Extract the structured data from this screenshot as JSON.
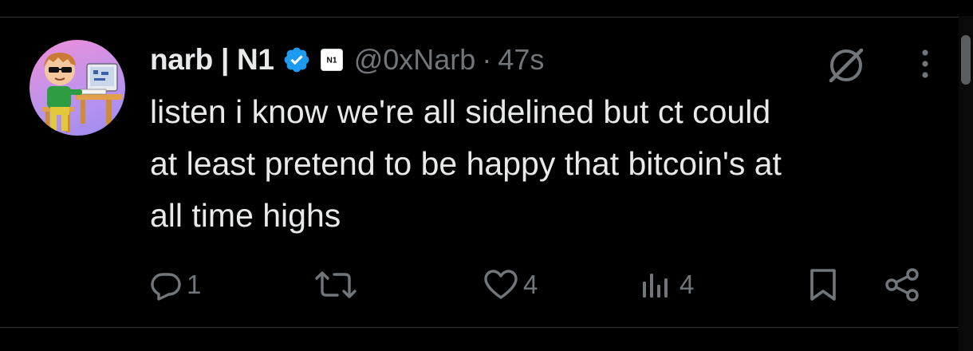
{
  "post": {
    "author_name": "narb | N1",
    "handle": "@0xNarb",
    "separator": "·",
    "timestamp": "47s",
    "text": "listen i know we're all sidelined but ct could\nat least pretend to be happy that bitcoin's at\nall time highs"
  },
  "badges": {
    "verified_color": "#1d9bf0",
    "affiliate_logo_text": "N1"
  },
  "actions": {
    "reply_count": "1",
    "repost_count": "",
    "like_count": "4",
    "views_count": "4"
  },
  "icons": {
    "reply": "reply-icon",
    "repost": "repost-icon",
    "like": "heart-icon",
    "views": "views-icon",
    "bookmark": "bookmark-icon",
    "share": "share-icon",
    "grok": "grok-icon",
    "more": "more-icon"
  },
  "colors": {
    "background": "#000000",
    "text": "#e7e9ea",
    "muted": "#71767b",
    "divider": "#2f3336"
  }
}
